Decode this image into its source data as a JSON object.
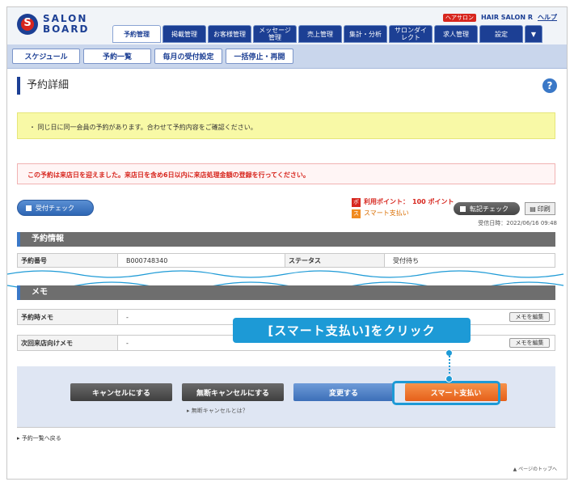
{
  "header": {
    "logo_line1": "SALON",
    "logo_line2": "BOARD",
    "account_badge": "ヘアサロン",
    "salon_name": "HAIR SALON R",
    "help": "ヘルプ",
    "nav": [
      {
        "label": "予約管理",
        "active": true
      },
      {
        "label": "掲載管理"
      },
      {
        "label": "お客様管理"
      },
      {
        "label": "メッセージ管理"
      },
      {
        "label": "売上管理"
      },
      {
        "label": "集計・分析"
      },
      {
        "label": "サロンダイレクト"
      },
      {
        "label": "求人管理"
      },
      {
        "label": "設定"
      }
    ],
    "nav_drop_icon": "triangle-down-icon",
    "subtabs": [
      "スケジュール",
      "予約一覧",
      "毎月の受付設定",
      "一括停止・再開"
    ]
  },
  "page": {
    "title": "予約詳細",
    "help_icon": "?",
    "notice_yellow": "・ 同じ日に同一会員の予約があります。合わせて予約内容をご確認ください。",
    "notice_red": "この予約は来店日を迎えました。来店日を含め6日以内に来店処理金額の登録を行ってください。",
    "accept_check": "受付チェック",
    "points_badge": "ポ",
    "points_label": "利用ポイント：",
    "points_value": "100 ポイント",
    "smart_badge": "ス",
    "smart_pay_label": "スマート支払い",
    "tenki_check": "転記チェック",
    "print": "印刷",
    "received_date": "受信日時：2022/06/16 09:48"
  },
  "reservation_info": {
    "section_title": "予約情報",
    "reservation_no_label": "予約番号",
    "reservation_no": "B000748340",
    "status_label": "ステータス",
    "status": "受付待ち"
  },
  "memo": {
    "section_title": "メモ",
    "rows": [
      {
        "label": "予約時メモ",
        "value": "-",
        "button": "メモを編集"
      },
      {
        "label": "次回来店向けメモ",
        "value": "-",
        "button": "メモを編集"
      }
    ]
  },
  "actions": {
    "cancel": "キャンセルにする",
    "noshow_cancel": "無断キャンセルにする",
    "change": "変更する",
    "smart_pay": "スマート支払い",
    "noshow_note": "▸ 無断キャンセルとは？"
  },
  "callout": "[スマート支払い]をクリック",
  "footer": {
    "back_link": "予約一覧へ戻る",
    "pagetop": "▲ ページのトップへ"
  },
  "colors": {
    "brand_navy": "#1c3f94",
    "accent_blue": "#1d9ad6",
    "smart_orange": "#e6601a",
    "alert_red": "#d7261e"
  }
}
